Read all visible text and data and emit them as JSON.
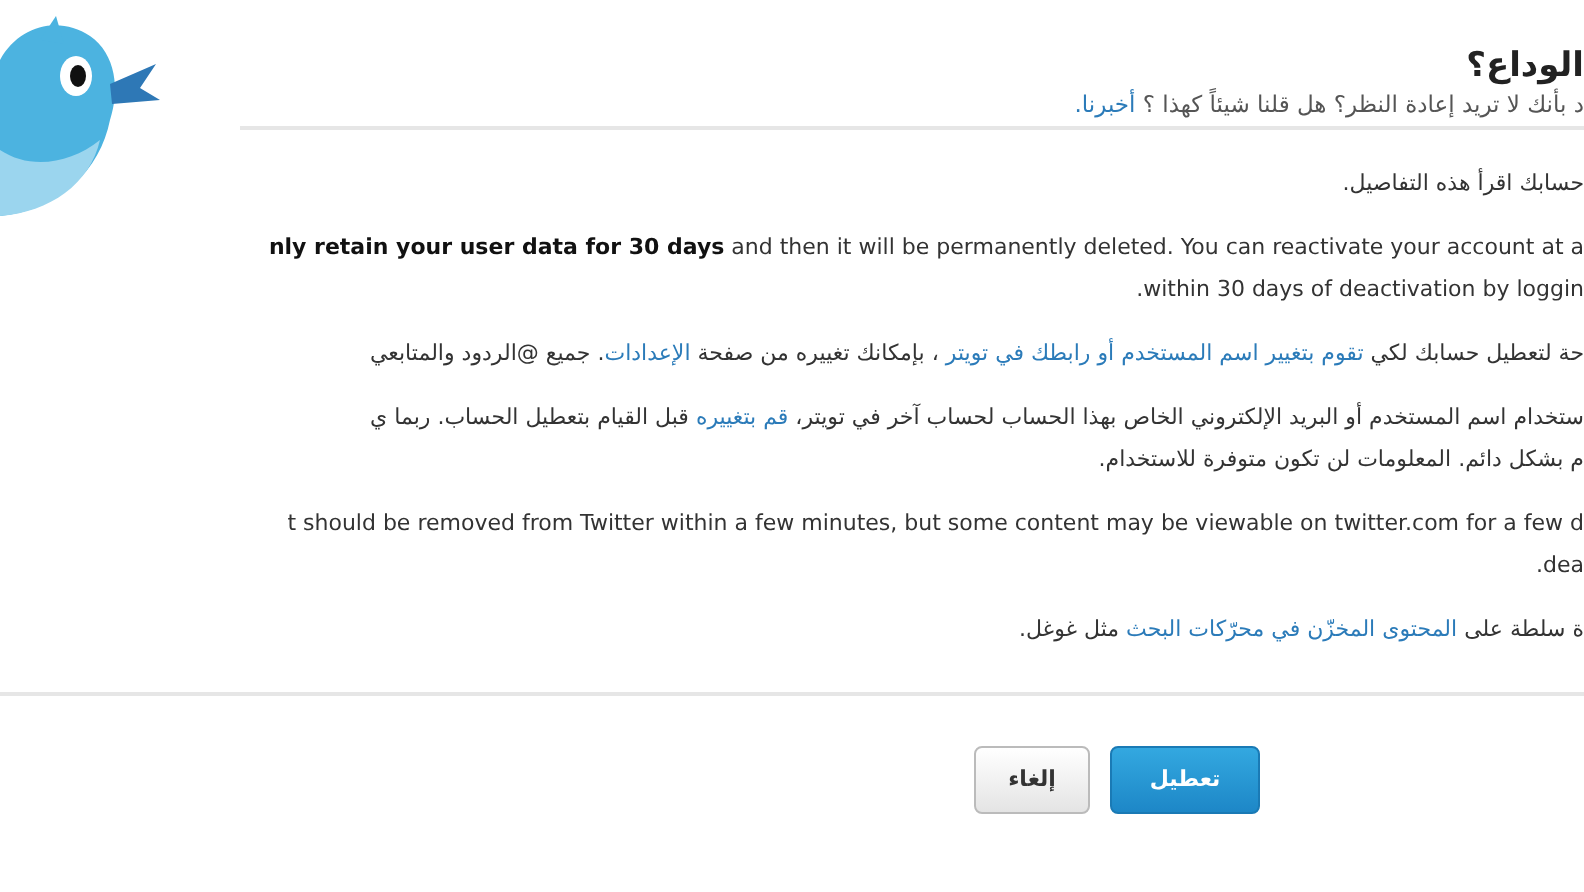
{
  "header": {
    "title": "الوداع؟",
    "subtitle": [
      {
        "kind": "plain",
        "text": "د بأنك لا تريد إعادة النظر؟ هل قلنا شيئاً كهذا ؟ "
      },
      {
        "kind": "link",
        "text": "أخبرنا."
      }
    ]
  },
  "paragraphs": [
    {
      "lines": [
        [
          {
            "kind": "plain",
            "text": "حسابك اقرأ هذه التفاصيل."
          }
        ]
      ]
    },
    {
      "lines": [
        [
          {
            "kind": "plain",
            "text": "**nly retain your user data for 30 days** and then it will be permanently deleted. You can reactivate your account at a"
          }
        ],
        [
          {
            "kind": "plain",
            "text": ".within 30 days of deactivation by loggin"
          }
        ]
      ]
    },
    {
      "lines": [
        [
          {
            "kind": "plain",
            "text": "حة لتعطيل حسابك لكي "
          },
          {
            "kind": "link",
            "text": "تقوم بتغيير اسم المستخدم أو رابطك في تويتر"
          },
          {
            "kind": "plain",
            "text": " ، بإمكانك تغييره من صفحة "
          },
          {
            "kind": "link",
            "text": "الإعدادات"
          },
          {
            "kind": "plain",
            "text": ". جميع @الردود والمتابعي"
          }
        ]
      ]
    },
    {
      "lines": [
        [
          {
            "kind": "plain",
            "text": "ستخدام اسم المستخدم أو البريد الإلكتروني الخاص بهذا الحساب لحساب آخر في تويتر، "
          },
          {
            "kind": "link",
            "text": "قم بتغييره"
          },
          {
            "kind": "plain",
            "text": " قبل القيام بتعطيل الحساب. ربما ي"
          }
        ],
        [
          {
            "kind": "plain",
            "text": "م بشكل دائم. المعلومات لن تكون متوفرة للاستخدام."
          }
        ]
      ]
    },
    {
      "lines": [
        [
          {
            "kind": "plain",
            "text": "t should be removed from Twitter within a few minutes, but some content may be viewable on twitter.com for a few d"
          }
        ],
        [
          {
            "kind": "plain",
            "text": ".dea"
          }
        ]
      ]
    },
    {
      "lines": [
        [
          {
            "kind": "plain",
            "text": "ة سلطة على "
          },
          {
            "kind": "link",
            "text": "المحتوى المخزّن في محرّكات البحث"
          },
          {
            "kind": "plain",
            "text": " مثل غوغل."
          }
        ]
      ]
    }
  ],
  "buttons": [
    {
      "kind": "primary",
      "label": "تعطيل"
    },
    {
      "kind": "secondary",
      "label": "إلغاء"
    }
  ]
}
